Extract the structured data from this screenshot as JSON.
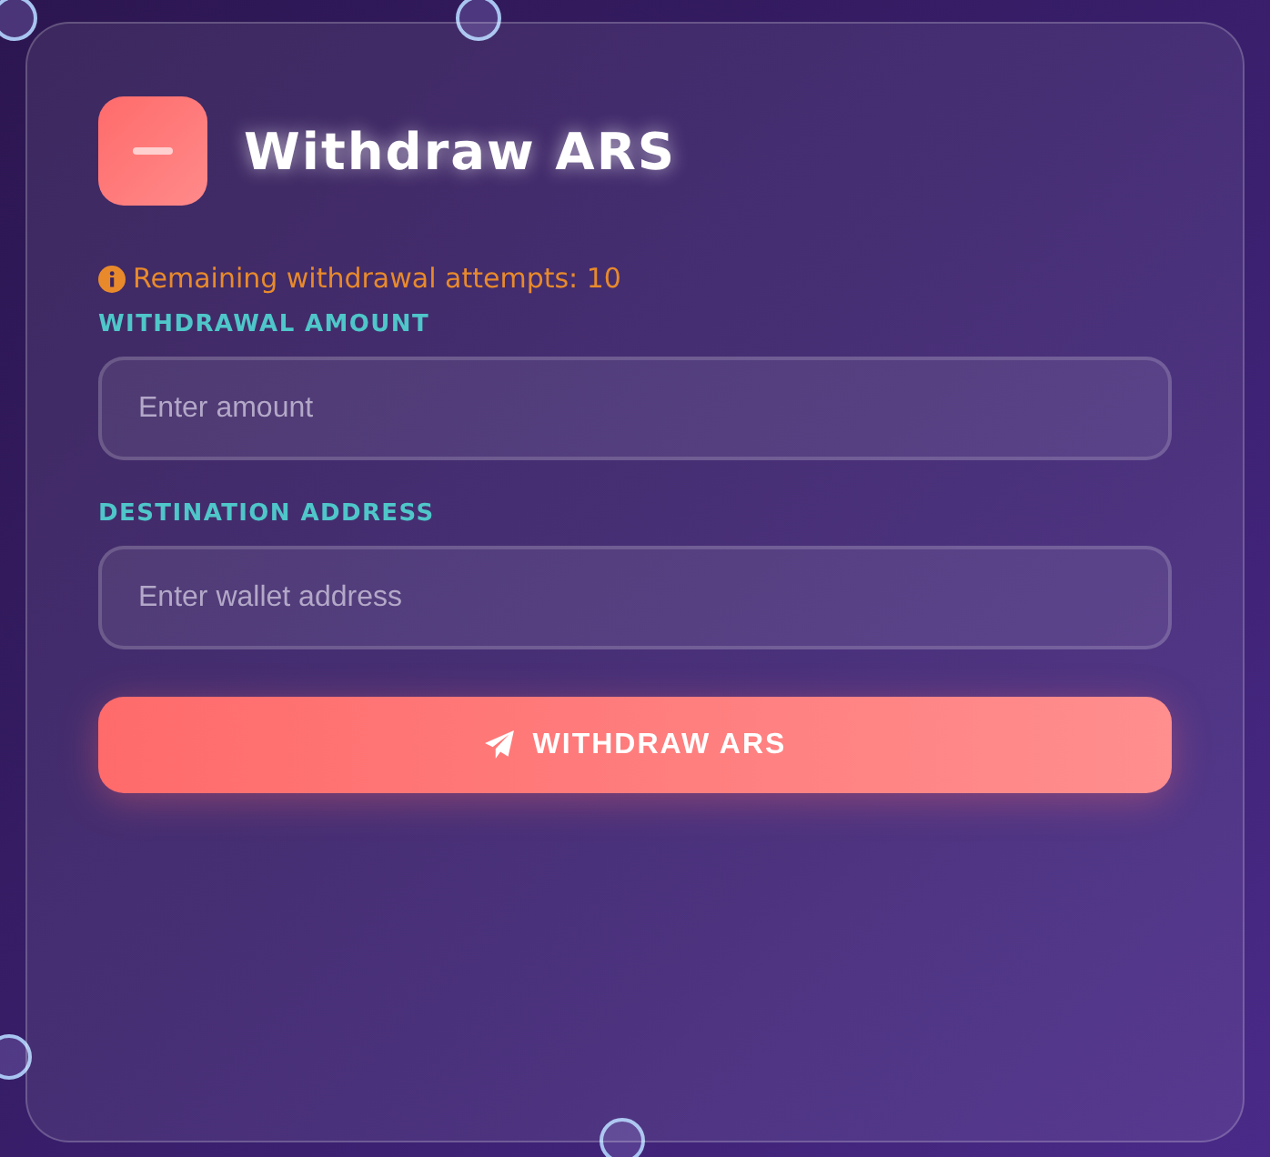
{
  "title": "Withdraw ARS",
  "notice": "Remaining withdrawal attempts: 10",
  "fields": [
    {
      "label": "WITHDRAWAL AMOUNT",
      "placeholder": "Enter amount"
    },
    {
      "label": "DESTINATION ADDRESS",
      "placeholder": "Enter wallet address"
    }
  ],
  "button": "WITHDRAW ARS"
}
